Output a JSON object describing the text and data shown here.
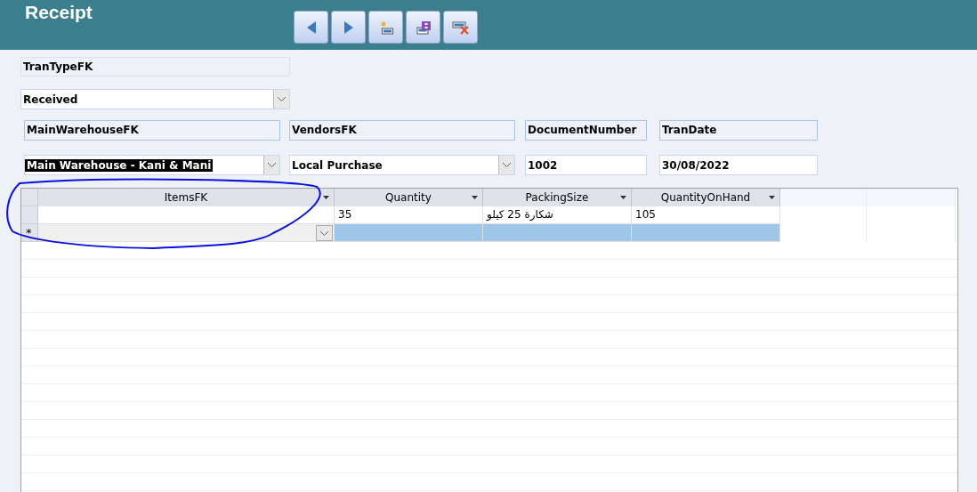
{
  "title": "Receipt",
  "toolbar": [
    {
      "kind": "previous"
    },
    {
      "kind": "next"
    },
    {
      "kind": "new"
    },
    {
      "kind": "save"
    },
    {
      "kind": "delete"
    }
  ],
  "tran_type": {
    "label": "TranTypeFK",
    "value": "Received"
  },
  "fields": [
    {
      "label": "MainWarehouseFK",
      "value": "Main Warehouse - Kani & Mani",
      "kind": "combo",
      "highlighted": true
    },
    {
      "label": "VendorsFK",
      "value": "Local Purchase",
      "kind": "combo",
      "highlighted": false
    },
    {
      "label": "DocumentNumber",
      "value": "1002",
      "kind": "text",
      "highlighted": false
    },
    {
      "label": "TranDate",
      "value": "30/08/2022",
      "kind": "text",
      "highlighted": false
    }
  ],
  "table": {
    "columns": [
      "ItemsFK",
      "Quantity",
      "PackingSize",
      "QuantityOnHand"
    ],
    "rows": [
      {
        "cells": [
          "",
          "35",
          "شكارة 25 كيلو",
          "105"
        ]
      }
    ],
    "new_row": {
      "marker": "*",
      "selected": true
    }
  },
  "annotation": {
    "kind": "circle"
  }
}
